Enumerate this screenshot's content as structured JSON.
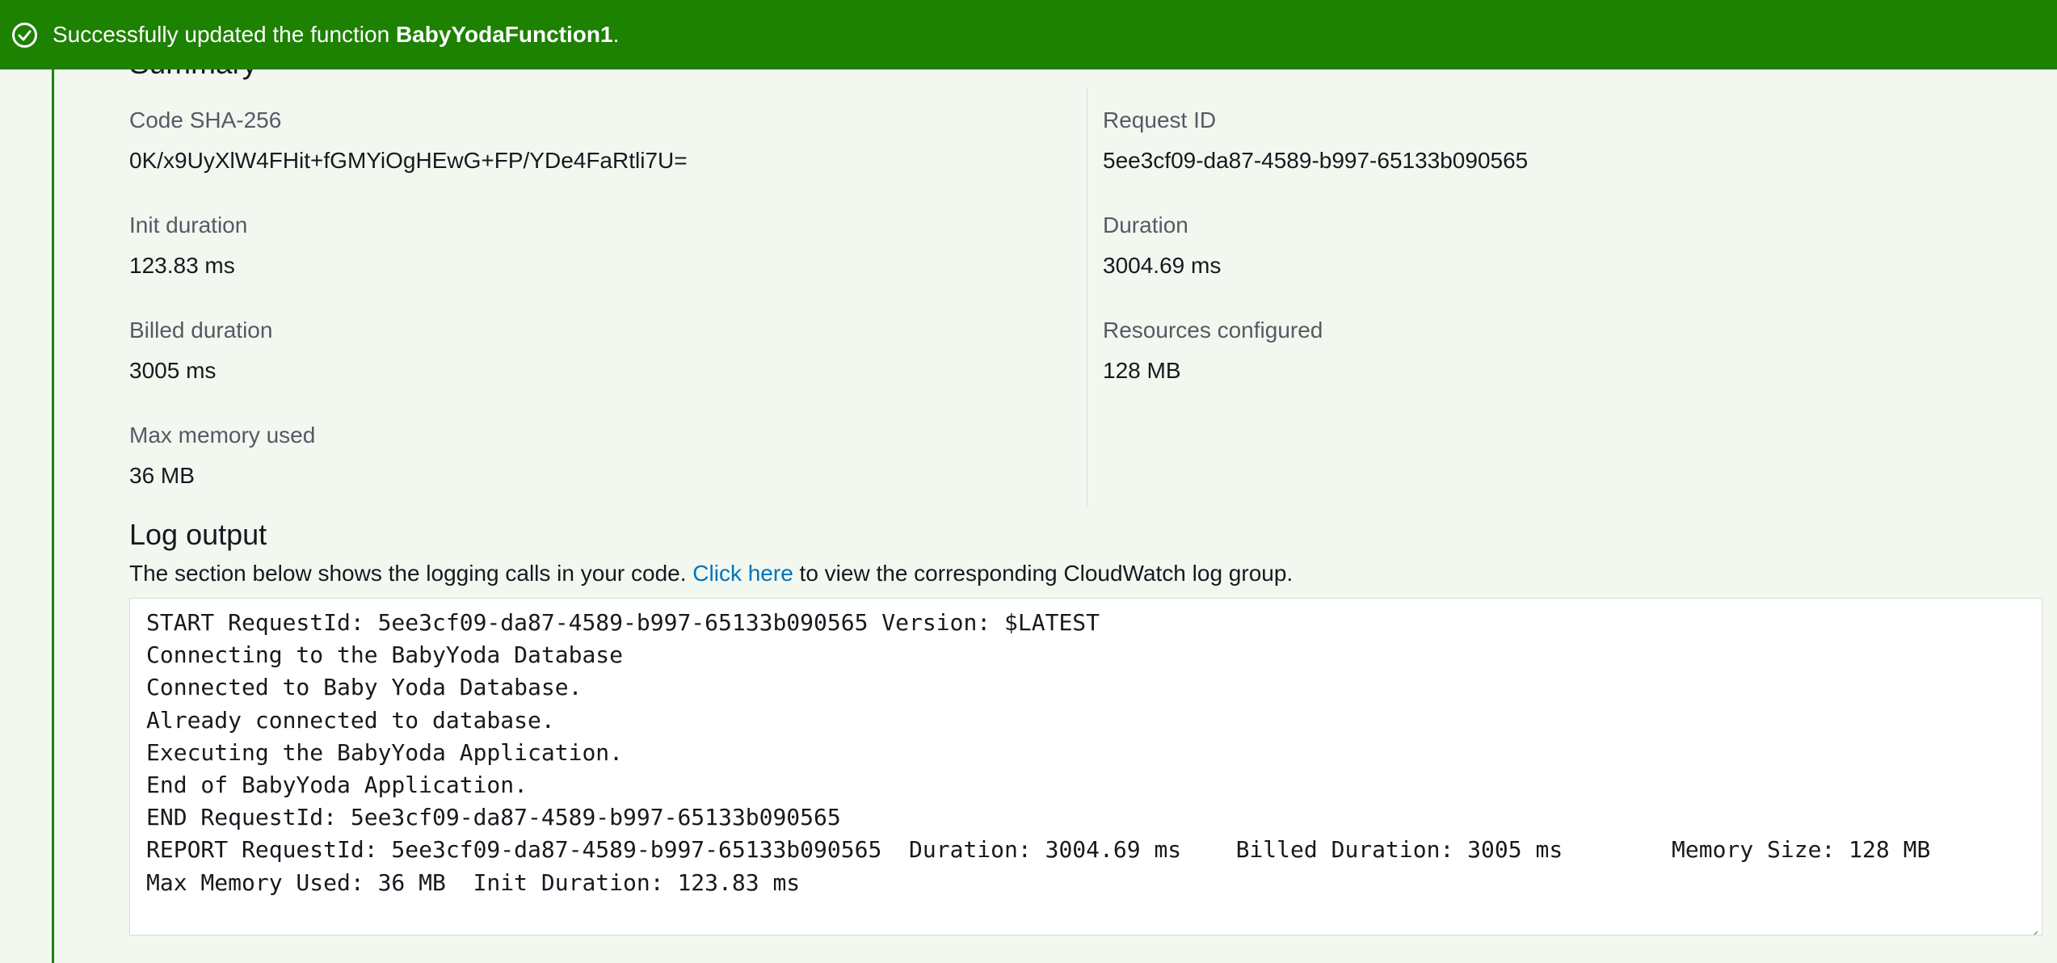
{
  "banner": {
    "message_prefix": "Successfully updated the function ",
    "function_name": "BabyYodaFunction1",
    "message_suffix": ".",
    "icon": "check-circle-icon",
    "color": "#1d8102"
  },
  "summary": {
    "heading": "Summary",
    "left": [
      {
        "label": "Code SHA-256",
        "value": "0K/x9UyXlW4FHit+fGMYiOgHEwG+FP/YDe4FaRtli7U="
      },
      {
        "label": "Init duration",
        "value": "123.83 ms"
      },
      {
        "label": "Billed duration",
        "value": "3005 ms"
      },
      {
        "label": "Max memory used",
        "value": "36 MB"
      }
    ],
    "right": [
      {
        "label": "Request ID",
        "value": "5ee3cf09-da87-4589-b997-65133b090565"
      },
      {
        "label": "Duration",
        "value": "3004.69 ms"
      },
      {
        "label": "Resources configured",
        "value": "128 MB"
      }
    ]
  },
  "log_output": {
    "title": "Log output",
    "desc_prefix": "The section below shows the logging calls in your code. ",
    "link_text": "Click here",
    "desc_suffix": " to view the corresponding CloudWatch log group.",
    "lines": [
      "START RequestId: 5ee3cf09-da87-4589-b997-65133b090565 Version: $LATEST",
      "Connecting to the BabyYoda Database",
      "Connected to Baby Yoda Database.",
      "Already connected to database.",
      "Executing the BabyYoda Application.",
      "End of BabyYoda Application.",
      "END RequestId: 5ee3cf09-da87-4589-b997-65133b090565",
      "REPORT RequestId: 5ee3cf09-da87-4589-b997-65133b090565  Duration: 3004.69 ms    Billed Duration: 3005 ms        Memory Size: 128 MB",
      "Max Memory Used: 36 MB  Init Duration: 123.83 ms"
    ]
  }
}
